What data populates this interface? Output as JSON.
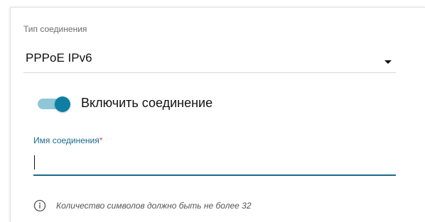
{
  "connection_type": {
    "label": "Тип соединения",
    "selected_value": "PPPoE IPv6"
  },
  "enable_toggle": {
    "label": "Включить соединение",
    "checked": true
  },
  "connection_name": {
    "label": "Имя соединения",
    "required_mark": "*",
    "value": ""
  },
  "hint": {
    "text": "Количество символов должно быть не более 32",
    "icon": "info-icon"
  },
  "colors": {
    "accent": "#0e7fa3",
    "focus_underline": "#1c6b8c",
    "required": "#e0454a"
  }
}
